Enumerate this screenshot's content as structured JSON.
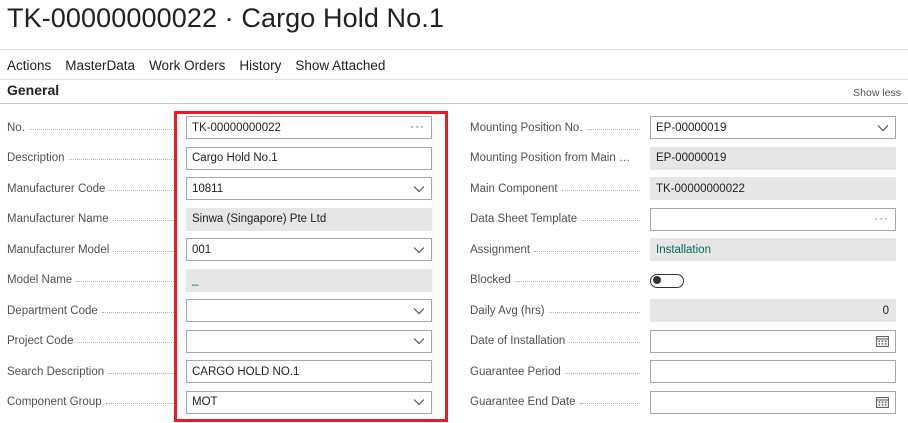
{
  "header": {
    "title": "TK-00000000022 · Cargo Hold No.1"
  },
  "actions": [
    "Actions",
    "MasterData",
    "Work Orders",
    "History",
    "Show Attached"
  ],
  "section": {
    "title": "General",
    "toggle_label": "Show less"
  },
  "left": [
    {
      "label": "No.",
      "value": "TK-00000000022"
    },
    {
      "label": "Description",
      "value": "Cargo Hold No.1"
    },
    {
      "label": "Manufacturer Code",
      "value": "10811"
    },
    {
      "label": "Manufacturer Name",
      "value": "Sinwa (Singapore) Pte Ltd"
    },
    {
      "label": "Manufacturer Model",
      "value": "001"
    },
    {
      "label": "Model Name",
      "value": "_"
    },
    {
      "label": "Department Code",
      "value": ""
    },
    {
      "label": "Project Code",
      "value": ""
    },
    {
      "label": "Search Description",
      "value": "CARGO HOLD NO.1"
    },
    {
      "label": "Component Group",
      "value": "MOT"
    }
  ],
  "right": [
    {
      "label": "Mounting Position No.",
      "value": "EP-00000019"
    },
    {
      "label": "Mounting Position from Main C...",
      "value": "EP-00000019"
    },
    {
      "label": "Main Component",
      "value": "TK-00000000022"
    },
    {
      "label": "Data Sheet Template",
      "value": ""
    },
    {
      "label": "Assignment",
      "value": "Installation"
    },
    {
      "label": "Blocked",
      "value": ""
    },
    {
      "label": "Daily Avg (hrs)",
      "value": "0"
    },
    {
      "label": "Date of Installation",
      "value": ""
    },
    {
      "label": "Guarantee Period",
      "value": ""
    },
    {
      "label": "Guarantee End Date",
      "value": ""
    }
  ],
  "icons": {
    "lookup": "ellipsis-icon",
    "dropdown": "chevron-down-icon",
    "date": "calendar-icon"
  },
  "colors": {
    "accent": "#00695c",
    "highlight": "#e31e24",
    "readonly_bg": "#e6e6e6"
  }
}
